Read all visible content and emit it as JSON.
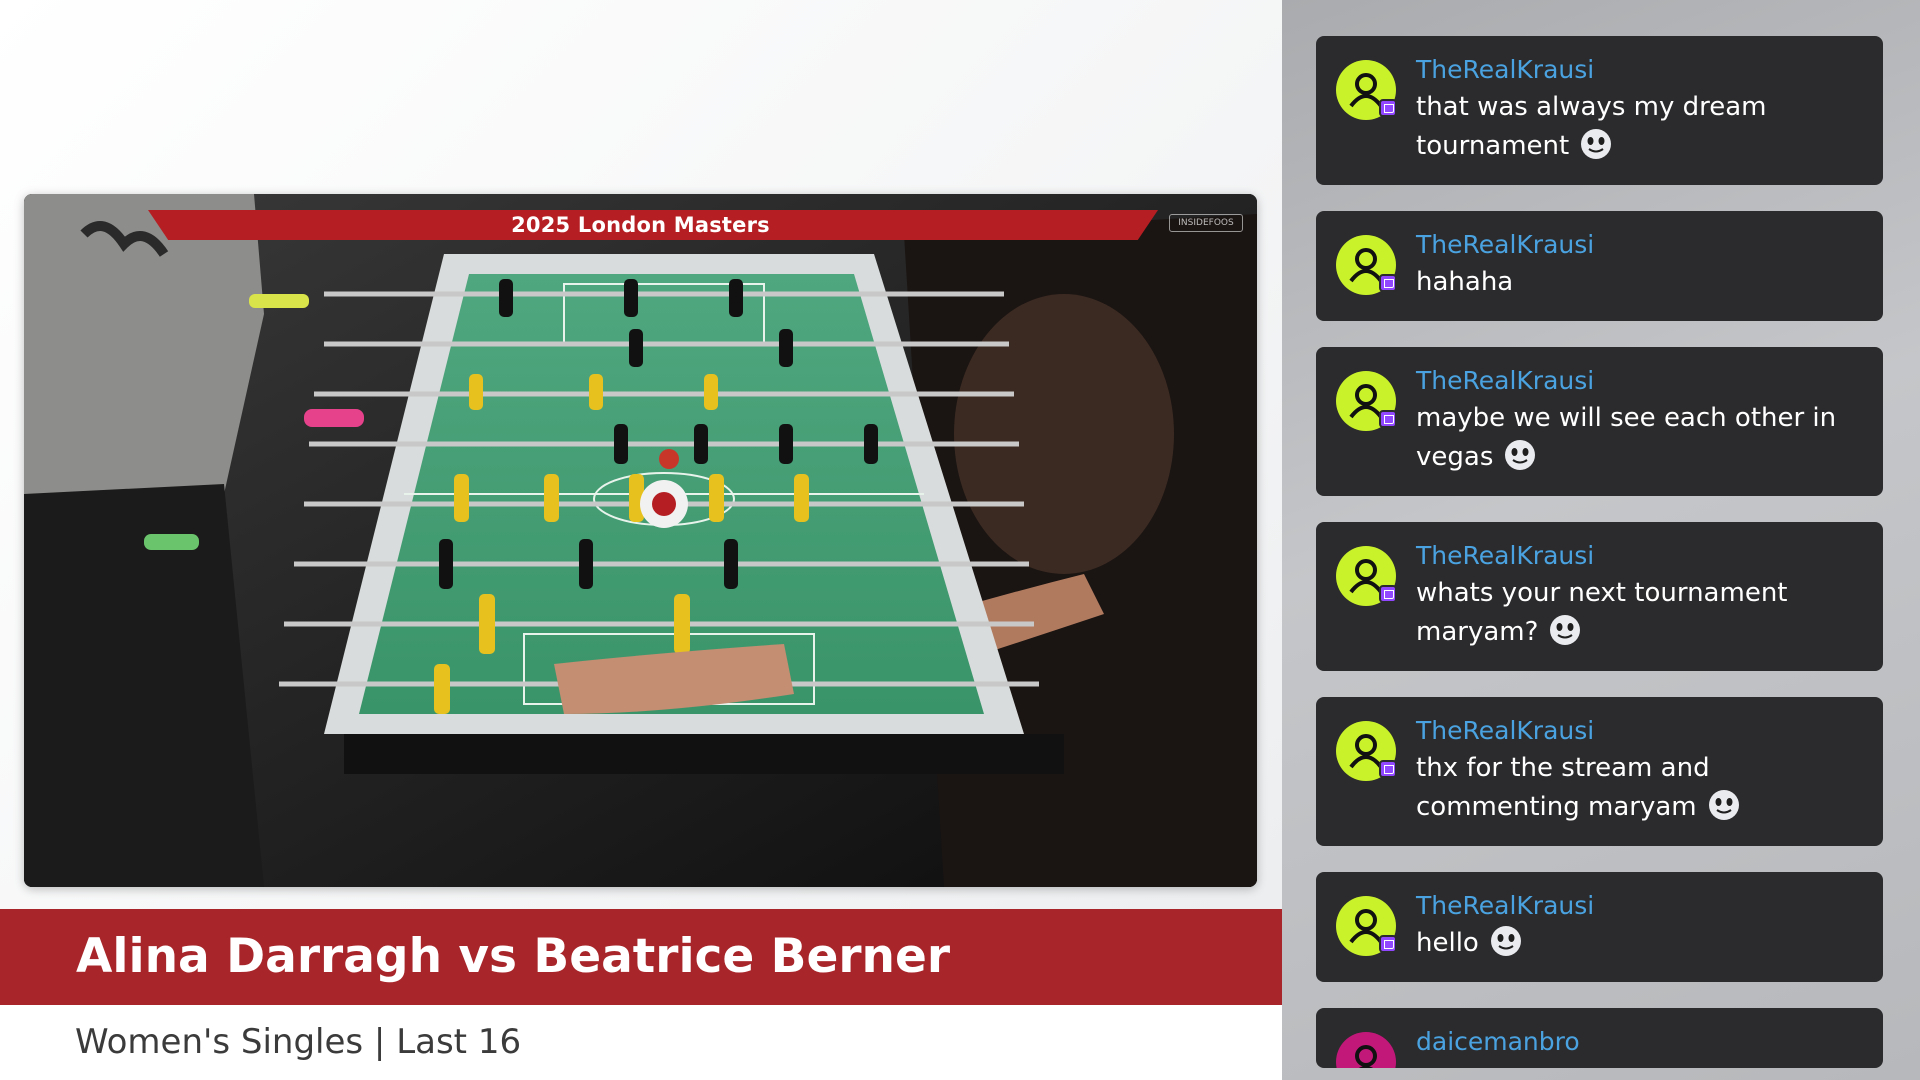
{
  "stream": {
    "tournament_banner": "2025 London Masters",
    "watermark": "INSIDEFOOS",
    "match_title": "Alina Darragh vs Beatrice Berner",
    "match_subtitle": "Women's Singles | Last 16"
  },
  "colors": {
    "banner_red": "#b51f23",
    "match_bar_red": "#a8262a",
    "chat_bubble": "#2b2b2d",
    "username_blue": "#4aa3e0",
    "avatar_green": "#c9f22b",
    "platform_badge_purple": "#9146ff"
  },
  "chat": {
    "messages": [
      {
        "user": "TheRealKrausi",
        "text": "that was always my dream tournament",
        "emote": "smile-emote"
      },
      {
        "user": "TheRealKrausi",
        "text": "hahaha"
      },
      {
        "user": "TheRealKrausi",
        "text": "maybe we will see each other in vegas",
        "emote": "smile-emote"
      },
      {
        "user": "TheRealKrausi",
        "text": "whats your next tournament maryam?",
        "emote": "smile-emote"
      },
      {
        "user": "TheRealKrausi",
        "text": "thx for the stream and commenting maryam",
        "emote": "smile-emote"
      },
      {
        "user": "TheRealKrausi",
        "text": "hello",
        "emote": "smile-emote"
      },
      {
        "user": "daicemanbro"
      }
    ]
  }
}
